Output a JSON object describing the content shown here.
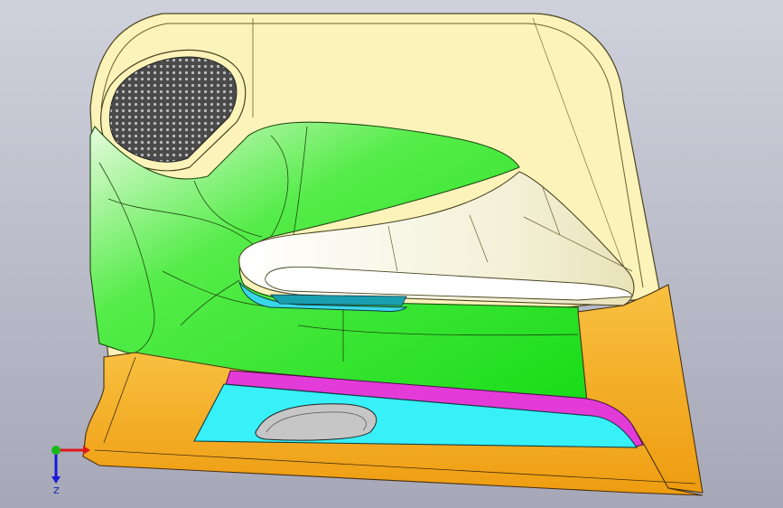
{
  "viewport": {
    "background_top": "#cfd1dc",
    "background_bottom": "#a6a8b8"
  },
  "model": {
    "name": "door-trim-panel",
    "parts": [
      {
        "name": "upper-trim",
        "color": "#fbf3b9"
      },
      {
        "name": "speaker-grille",
        "color": "#3a3a3a"
      },
      {
        "name": "main-panel",
        "color": "#22e024"
      },
      {
        "name": "armrest",
        "color": "#f7f4dc"
      },
      {
        "name": "pull-handle-insert",
        "color": "#3ad7e8"
      },
      {
        "name": "lower-trim",
        "color": "#f2a81f"
      },
      {
        "name": "map-pocket",
        "color": "#37f0f8"
      },
      {
        "name": "trim-strip",
        "color": "#e23bd8"
      }
    ]
  },
  "triad": {
    "x_axis_color": "#e01818",
    "y_axis_color": "#18b818",
    "z_axis_color": "#1818d8",
    "z_label": "Z"
  }
}
